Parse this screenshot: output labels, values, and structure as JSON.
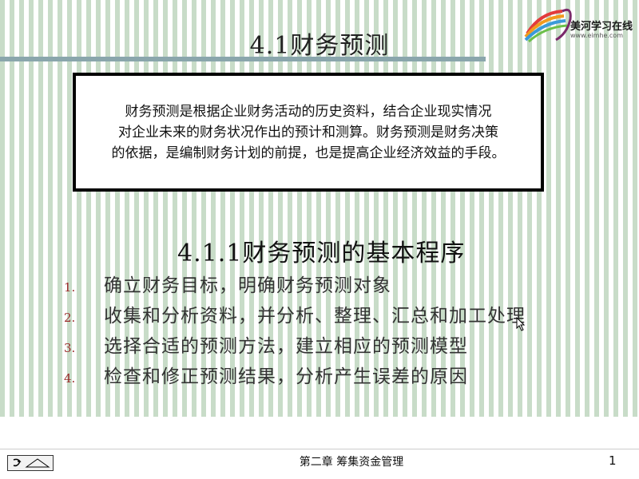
{
  "slide": {
    "title": "4.1财务预测",
    "logo": {
      "name": "美河学习在线",
      "url": "www.eimhe.com"
    },
    "definition": [
      "财务预测是根据企业财务活动的历史资料，结合企业现实情况",
      "对企业未来的财务状况作出的预计和测算。财务预测是财务决策",
      "的依据，是编制财务计划的前提，也是提高企业经济效益的手段。"
    ],
    "section_heading": "4.1.1财务预测的基本程序",
    "steps": [
      {
        "number": "1.",
        "text": "确立财务目标，明确财务预测对象"
      },
      {
        "number": "2.",
        "text": "收集和分析资料，并分析、整理、汇总和加工处理"
      },
      {
        "number": "3.",
        "text": "选择合适的预测方法，建立相应的预测模型"
      },
      {
        "number": "4.",
        "text": "检查和修正预测结果，分析产生误差的原因"
      }
    ]
  },
  "footer": {
    "chapter": "第二章 筹集资金管理",
    "page_number": "1",
    "nav_icon": "slide-show-menu-icon"
  },
  "colors": {
    "stripe": "#c8dcc8",
    "title_rule": "#8aa6ac",
    "step_number": "#9a2a2a"
  }
}
